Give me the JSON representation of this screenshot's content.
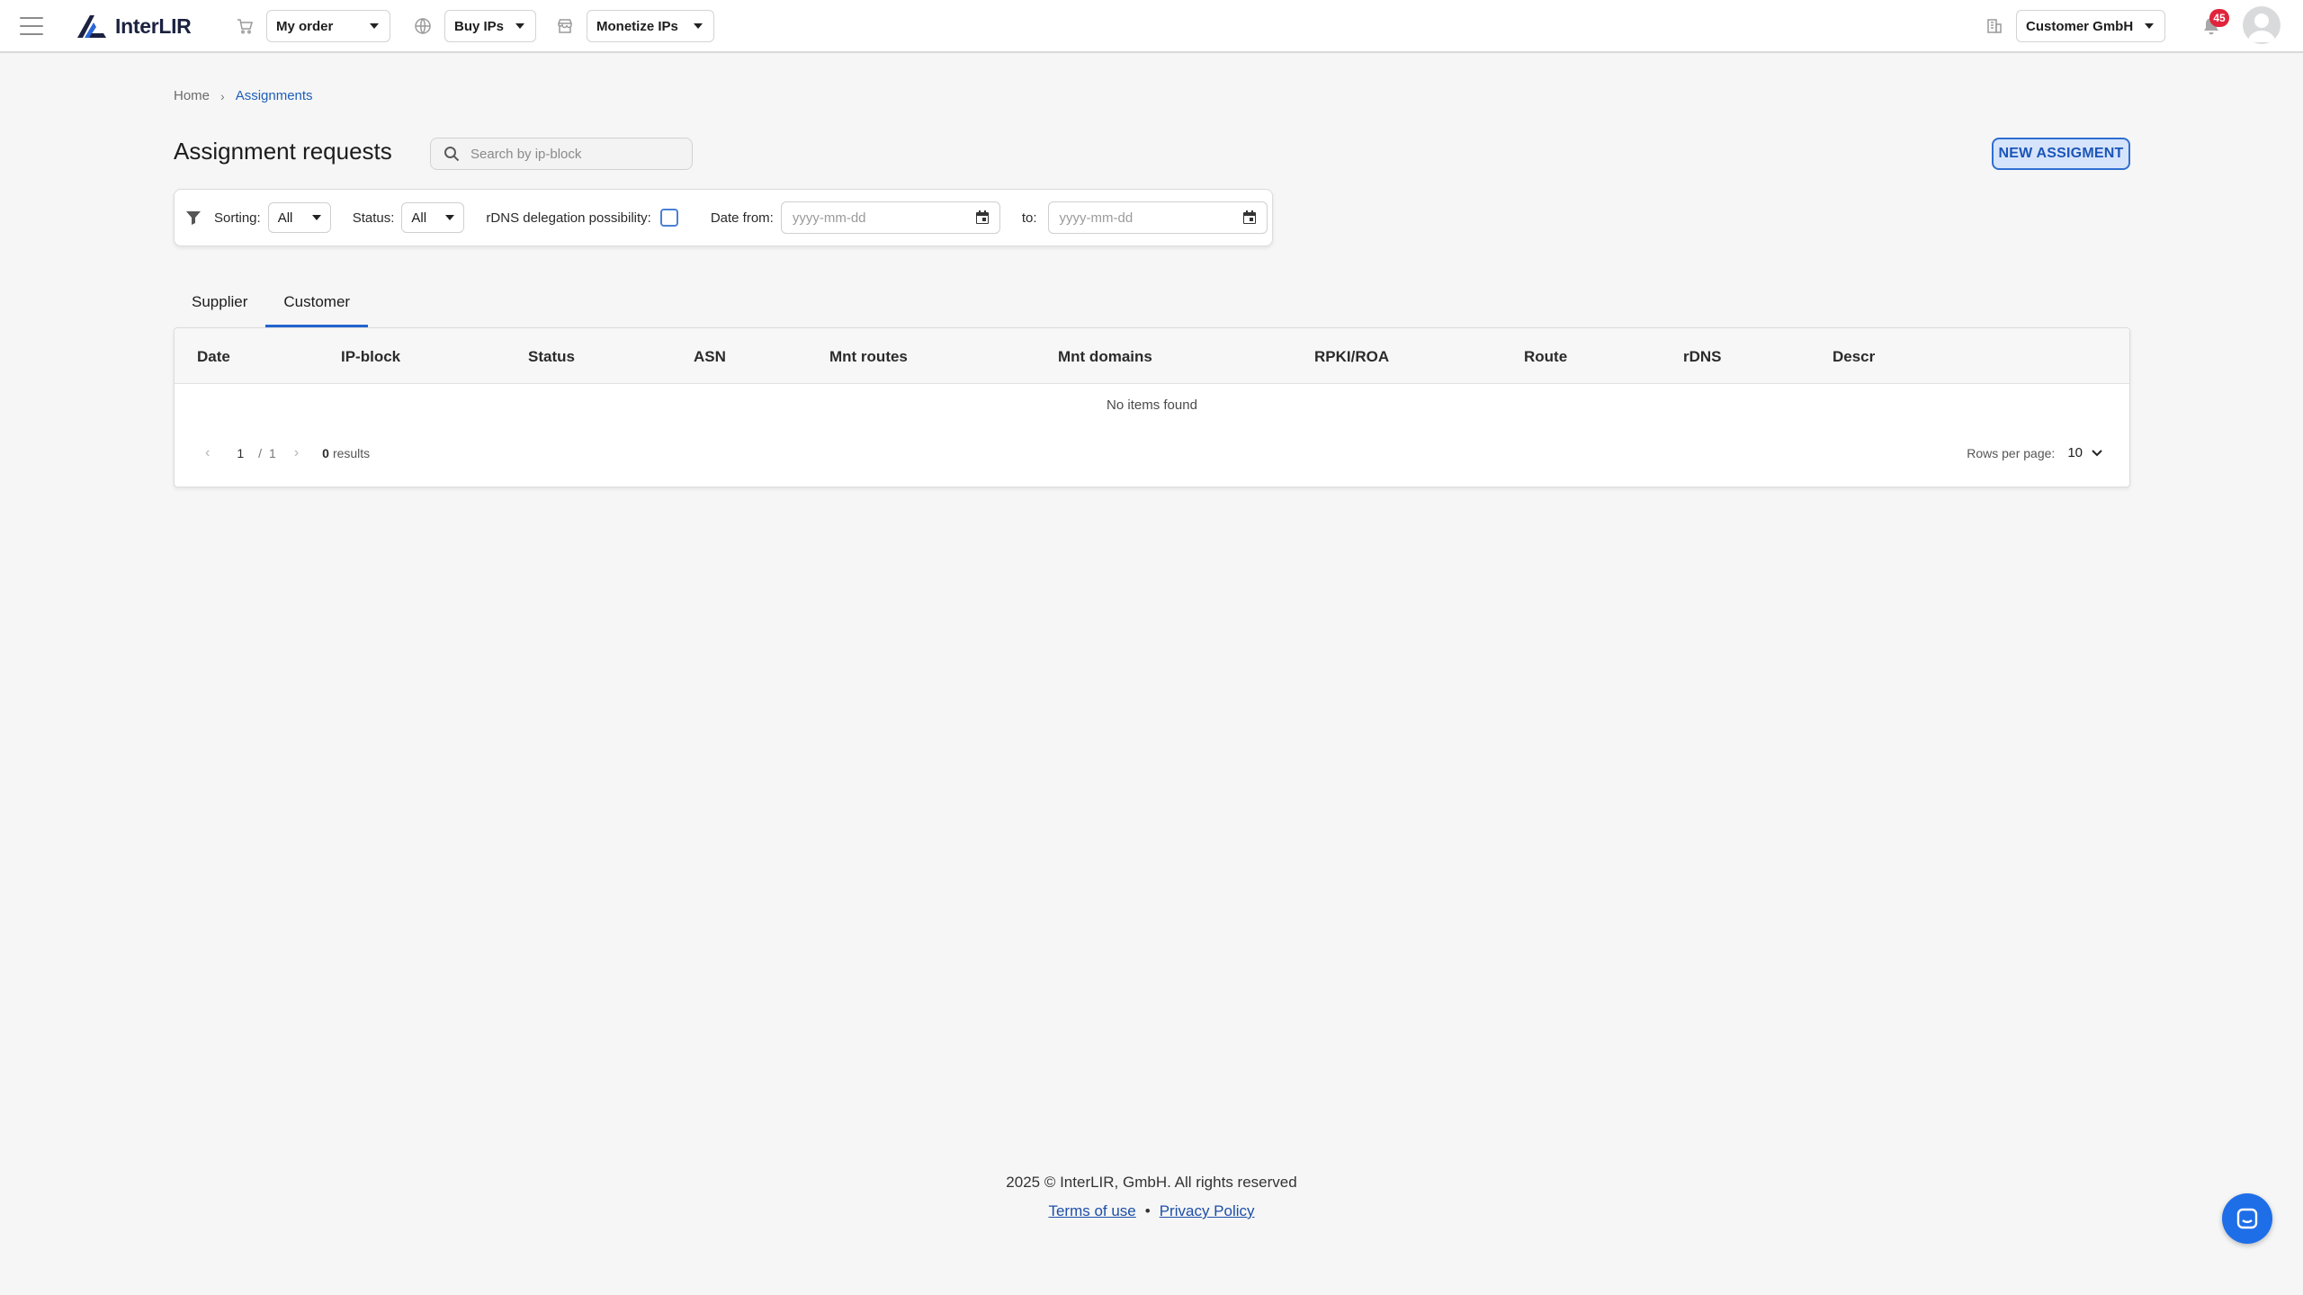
{
  "header": {
    "logo_text": "InterLIR",
    "nav": [
      {
        "label": "My order",
        "icon": "cart-icon"
      },
      {
        "label": "Buy IPs",
        "icon": "globe-icon"
      },
      {
        "label": "Monetize IPs",
        "icon": "store-icon"
      }
    ],
    "company": {
      "label": "Customer GmbH",
      "icon": "building-icon"
    },
    "notifications_count": "45"
  },
  "breadcrumb": {
    "home": "Home",
    "current": "Assignments"
  },
  "page": {
    "title": "Assignment requests",
    "new_button": "NEW ASSIGMENT"
  },
  "search": {
    "placeholder": "Search by ip-block"
  },
  "filters": {
    "sorting_label": "Sorting:",
    "sorting_value": "All",
    "status_label": "Status:",
    "status_value": "All",
    "rdns_label": "rDNS delegation possibility:",
    "date_from_label": "Date from:",
    "date_from_placeholder": "yyyy-mm-dd",
    "date_to_label": "to:",
    "date_to_placeholder": "yyyy-mm-dd"
  },
  "tabs": [
    {
      "label": "Supplier",
      "active": false
    },
    {
      "label": "Customer",
      "active": true
    }
  ],
  "table": {
    "columns": [
      "Date",
      "IP-block",
      "Status",
      "ASN",
      "Mnt routes",
      "Mnt domains",
      "RPKI/ROA",
      "Route",
      "rDNS",
      "Descr"
    ],
    "empty_text": "No items found"
  },
  "pagination": {
    "current": "1",
    "separator": "/",
    "total": "1",
    "results_count": "0",
    "results_label": "results",
    "rows_label": "Rows per page:",
    "rows_value": "10"
  },
  "footer": {
    "copyright": "2025 © InterLIR, GmbH. All rights reserved",
    "terms": "Terms of use",
    "dot": "•",
    "privacy": "Privacy Policy"
  },
  "colors": {
    "accent": "#2465d0",
    "badge": "#e0243b",
    "chat": "#1e6ee8"
  }
}
